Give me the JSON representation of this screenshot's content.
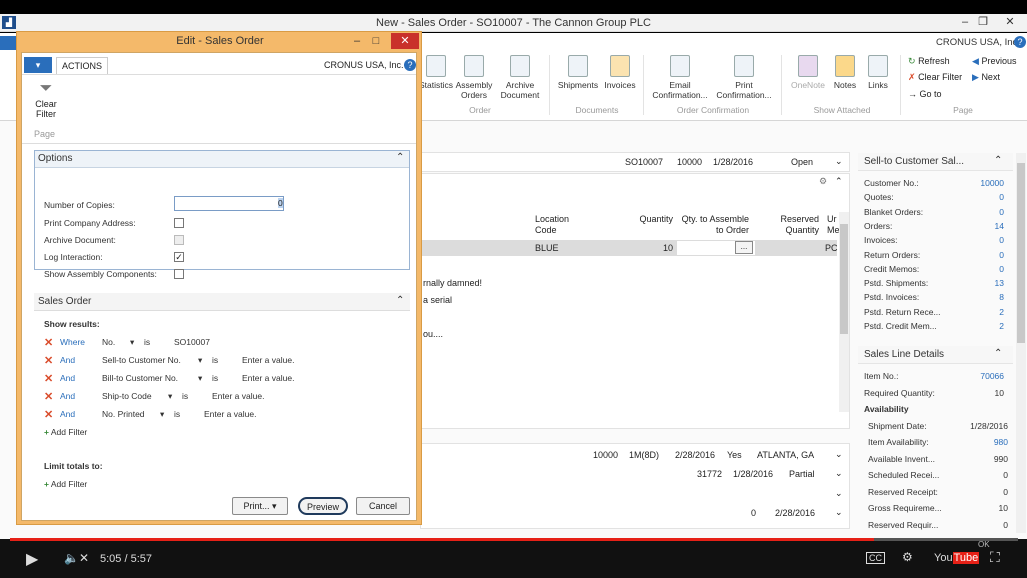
{
  "window": {
    "title": "New - Sales Order - SO10007 - The Cannon Group PLC",
    "company": "CRONUS USA, Inc.",
    "min": "–",
    "max": "❐",
    "close": "✕"
  },
  "ribbon": {
    "buttons": [
      {
        "label": "Statistics",
        "icon": "statistics-icon"
      },
      {
        "label": "Assembly Orders",
        "icon": "assembly-orders-icon"
      },
      {
        "label": "Archive Document",
        "icon": "archive-document-icon"
      },
      {
        "label": "Shipments",
        "icon": "shipments-icon"
      },
      {
        "label": "Invoices",
        "icon": "invoices-icon"
      },
      {
        "label": "Email Confirmation...",
        "icon": "email-icon"
      },
      {
        "label": "Print Confirmation...",
        "icon": "print-icon"
      },
      {
        "label": "OneNote",
        "icon": "onenote-icon"
      },
      {
        "label": "Notes",
        "icon": "notes-icon"
      },
      {
        "label": "Links",
        "icon": "links-icon"
      }
    ],
    "groups": [
      "Order",
      "Documents",
      "Order Confirmation",
      "Show Attached",
      "Page"
    ],
    "page_actions": [
      "Refresh",
      "Previous",
      "Clear Filter",
      "Next",
      "Go to"
    ]
  },
  "order_header": {
    "no": "SO10007",
    "line": "10000",
    "date": "1/28/2016",
    "status": "Open"
  },
  "lines": {
    "col_location": "Location Code",
    "col_quantity": "Quantity",
    "col_qty_assemble": "Qty. to Assemble to Order",
    "col_reserved": "Reserved Quantity",
    "col_unit": "Ur Me",
    "location": "BLUE",
    "quantity": "10",
    "unit": "PC",
    "ellipsis": "..."
  },
  "background_text": [
    "rnally damned!",
    "a serial",
    "ou...."
  ],
  "shipping_rows": [
    {
      "line": "10000",
      "code": "1M(8D)",
      "date": "2/28/2016",
      "flag": "Yes",
      "city": "ATLANTA, GA"
    },
    {
      "line": "31772",
      "code": "",
      "date": "1/28/2016",
      "flag": "Partial",
      "city": ""
    },
    {
      "line": "0",
      "code": "",
      "date": "2/28/2016",
      "flag": "",
      "city": ""
    }
  ],
  "factbox_customer": {
    "title": "Sell-to Customer Sal...",
    "rows": [
      {
        "label": "Customer No.:",
        "value": "10000"
      },
      {
        "label": "Quotes:",
        "value": "0"
      },
      {
        "label": "Blanket Orders:",
        "value": "0"
      },
      {
        "label": "Orders:",
        "value": "14"
      },
      {
        "label": "Invoices:",
        "value": "0"
      },
      {
        "label": "Return Orders:",
        "value": "0"
      },
      {
        "label": "Credit Memos:",
        "value": "0"
      },
      {
        "label": "Pstd. Shipments:",
        "value": "13"
      },
      {
        "label": "Pstd. Invoices:",
        "value": "8"
      },
      {
        "label": "Pstd. Return Rece...",
        "value": "2"
      },
      {
        "label": "Pstd. Credit Mem...",
        "value": "2"
      }
    ]
  },
  "factbox_line": {
    "title": "Sales Line Details",
    "rows": [
      {
        "label": "Item No.:",
        "value": "70066",
        "link": true
      },
      {
        "label": "Required Quantity:",
        "value": "10",
        "link": false
      },
      {
        "label": "Availability",
        "value": "",
        "link": false
      },
      {
        "label": "Shipment Date:",
        "value": "1/28/2016",
        "link": false
      },
      {
        "label": "Item Availability:",
        "value": "980",
        "link": true
      },
      {
        "label": "Available Invent...",
        "value": "990",
        "link": false
      },
      {
        "label": "Scheduled Recei...",
        "value": "0",
        "link": false
      },
      {
        "label": "Reserved Receipt:",
        "value": "0",
        "link": false
      },
      {
        "label": "Gross Requireme...",
        "value": "10",
        "link": false
      },
      {
        "label": "Reserved Requir...",
        "value": "0",
        "link": false
      }
    ]
  },
  "dialog": {
    "title": "Edit - Sales Order",
    "tab": "ACTIONS",
    "company": "CRONUS USA, Inc.",
    "clear_filter": "Clear Filter",
    "page_group": "Page",
    "options_title": "Options",
    "opt_copies": "Number of Copies:",
    "opt_print_address": "Print Company Address:",
    "opt_archive": "Archive Document:",
    "opt_log": "Log Interaction:",
    "opt_assembly": "Show Assembly Components:",
    "copies_value": "0",
    "sales_order_title": "Sales Order",
    "show_results": "Show results:",
    "filters": [
      {
        "conj": "Where",
        "field": "No.",
        "op": "is",
        "value": "SO10007",
        "empty": false
      },
      {
        "conj": "And",
        "field": "Sell-to Customer No.",
        "op": "is",
        "value": "Enter a value.",
        "empty": true
      },
      {
        "conj": "And",
        "field": "Bill-to Customer No.",
        "op": "is",
        "value": "Enter a value.",
        "empty": true
      },
      {
        "conj": "And",
        "field": "Ship-to Code",
        "op": "is",
        "value": "Enter a value.",
        "empty": true
      },
      {
        "conj": "And",
        "field": "No. Printed",
        "op": "is",
        "value": "Enter a value.",
        "empty": true
      }
    ],
    "add_filter": "Add Filter",
    "limit_totals": "Limit totals to:",
    "btn_print": "Print...",
    "btn_preview": "Preview",
    "btn_cancel": "Cancel"
  },
  "player": {
    "time": "5:05 / 5:57",
    "progress": 0.857,
    "ok_label": "OK"
  },
  "colors": {
    "accent": "#2a6ebb",
    "dialog_frame": "#f4b96a",
    "close_red": "#c9312b",
    "yt_red": "#e62117"
  }
}
